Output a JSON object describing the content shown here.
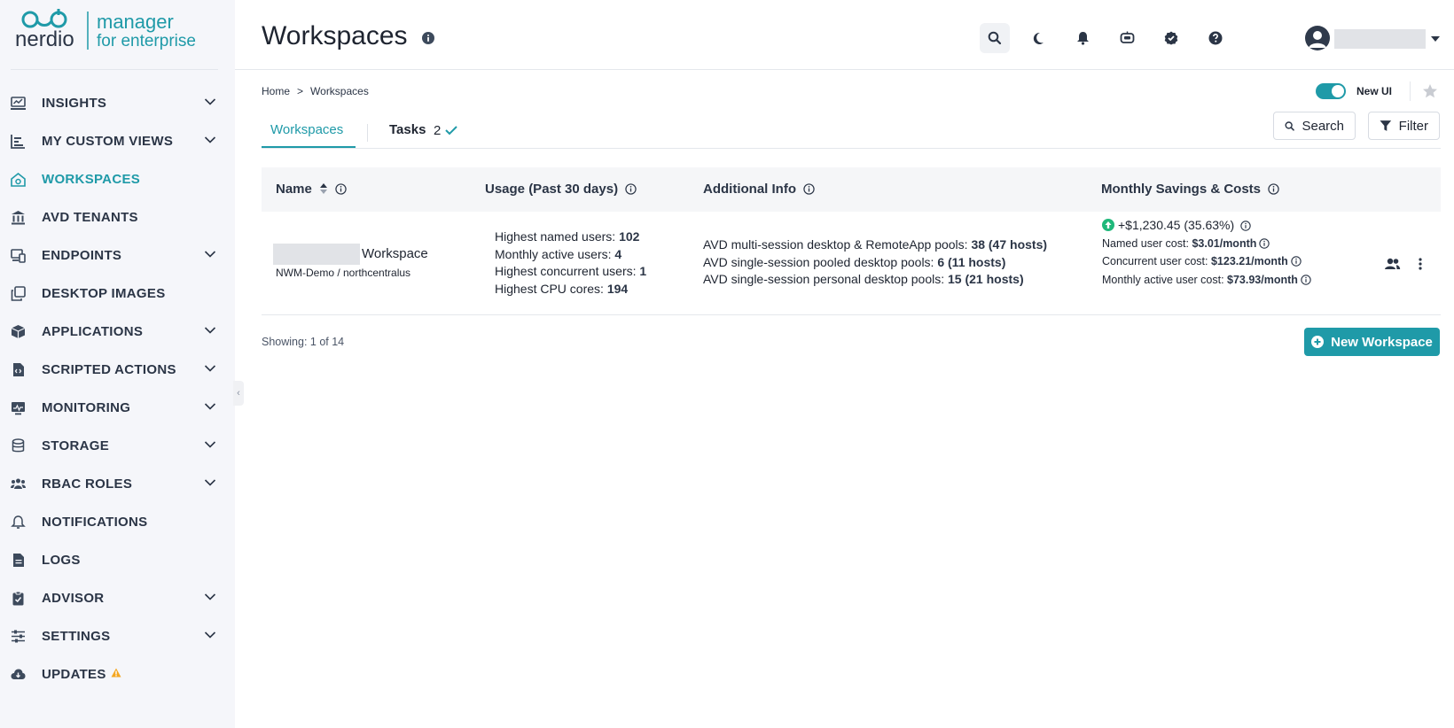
{
  "brand": {
    "name": "nerdio",
    "product_line1": "manager",
    "product_line2": "for enterprise",
    "accent": "#1f9aa8"
  },
  "sidebar": {
    "items": [
      {
        "label": "INSIGHTS",
        "icon": "insights-icon",
        "expandable": true
      },
      {
        "label": "MY CUSTOM VIEWS",
        "icon": "chart-icon",
        "expandable": true
      },
      {
        "label": "WORKSPACES",
        "icon": "workspaces-icon",
        "expandable": false,
        "active": true
      },
      {
        "label": "AVD TENANTS",
        "icon": "bank-icon",
        "expandable": false
      },
      {
        "label": "ENDPOINTS",
        "icon": "devices-icon",
        "expandable": true
      },
      {
        "label": "DESKTOP IMAGES",
        "icon": "copy-icon",
        "expandable": false
      },
      {
        "label": "APPLICATIONS",
        "icon": "box-icon",
        "expandable": true
      },
      {
        "label": "SCRIPTED ACTIONS",
        "icon": "script-file-icon",
        "expandable": true
      },
      {
        "label": "MONITORING",
        "icon": "monitor-icon",
        "expandable": true
      },
      {
        "label": "STORAGE",
        "icon": "database-icon",
        "expandable": true
      },
      {
        "label": "RBAC ROLES",
        "icon": "users-icon",
        "expandable": true
      },
      {
        "label": "NOTIFICATIONS",
        "icon": "bell-icon",
        "expandable": false
      },
      {
        "label": "LOGS",
        "icon": "document-icon",
        "expandable": false
      },
      {
        "label": "ADVISOR",
        "icon": "clipboard-check-icon",
        "expandable": true
      },
      {
        "label": "SETTINGS",
        "icon": "sliders-icon",
        "expandable": true
      },
      {
        "label": "UPDATES",
        "icon": "cloud-download-icon",
        "expandable": false,
        "warning": true
      }
    ]
  },
  "header": {
    "title": "Workspaces",
    "icons": [
      "search-icon",
      "moon-icon",
      "bell-icon",
      "chat-bot-icon",
      "badge-check-icon",
      "help-icon"
    ]
  },
  "breadcrumb": {
    "home": "Home",
    "separator": ">",
    "current": "Workspaces"
  },
  "ui_toggle": {
    "label": "New UI",
    "on": true
  },
  "tabs": {
    "workspaces": "Workspaces",
    "tasks": "Tasks",
    "tasks_count": "2"
  },
  "toolbar": {
    "search_label": "Search",
    "filter_label": "Filter"
  },
  "table": {
    "columns": {
      "name": "Name",
      "usage": "Usage (Past 30 days)",
      "additional": "Additional Info",
      "savings": "Monthly Savings & Costs"
    },
    "rows": [
      {
        "name_suffix": "Workspace",
        "subscription": "NWM-Demo / northcentralus",
        "usage": [
          {
            "label": "Highest named users: ",
            "value": "102"
          },
          {
            "label": "Monthly active users: ",
            "value": "4"
          },
          {
            "label": "Highest concurrent users: ",
            "value": "1"
          },
          {
            "label": "Highest CPU cores: ",
            "value": "194"
          }
        ],
        "additional": [
          {
            "label": "AVD multi-session desktop & RemoteApp pools: ",
            "value": "38 (47 hosts)"
          },
          {
            "label": "AVD single-session pooled desktop pools: ",
            "value": "6 (11 hosts)"
          },
          {
            "label": "AVD single-session personal desktop pools: ",
            "value": "15 (21 hosts)"
          }
        ],
        "savings": "+$1,230.45 (35.63%)",
        "costs": [
          {
            "label": "Named user cost: ",
            "value": "$3.01/month"
          },
          {
            "label": "Concurrent user cost: ",
            "value": "$123.21/month"
          },
          {
            "label": "Monthly active user cost: ",
            "value": "$73.93/month"
          }
        ]
      }
    ]
  },
  "footer": {
    "showing_label": "Showing: ",
    "showing_value": "1 of 14",
    "new_button": "New Workspace"
  }
}
